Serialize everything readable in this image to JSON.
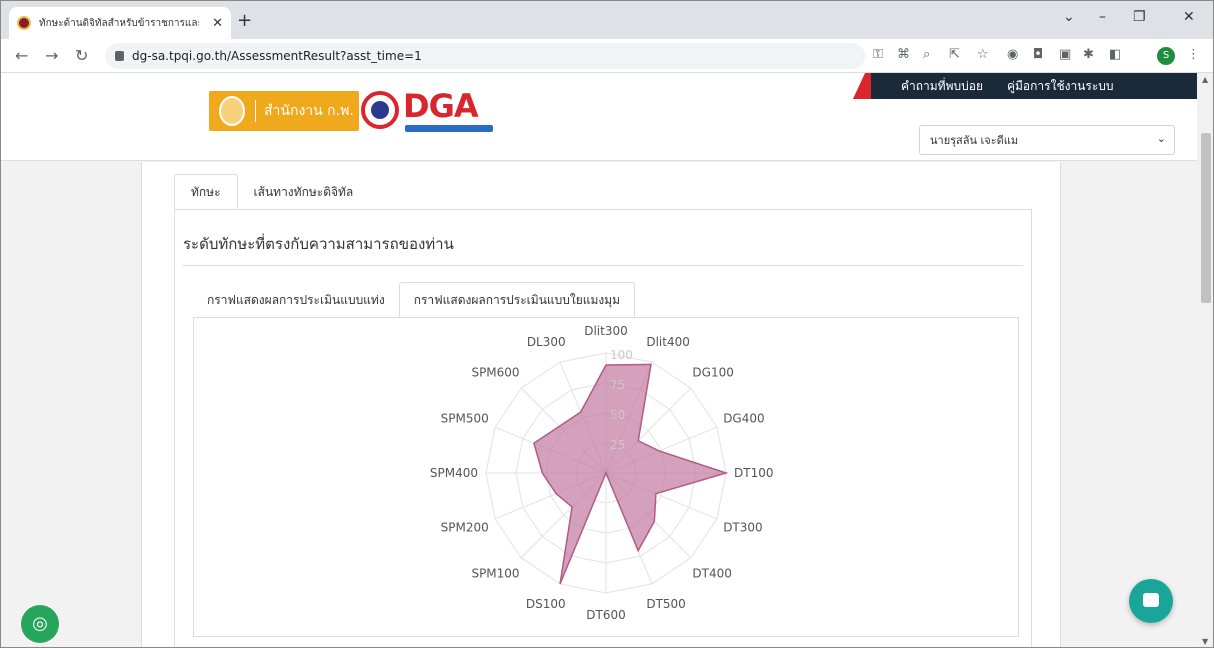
{
  "browser": {
    "tab_title": "ทักษะด้านดิจิทัลสำหรับข้าราชการและบุ",
    "url": "dg-sa.tpqi.go.th/AssessmentResult?asst_time=1",
    "profile_initial": "S"
  },
  "header": {
    "links": [
      "คำถามที่พบบ่อย",
      "คู่มือการใช้งานระบบ"
    ],
    "ocsc_logo_text": "สำนักงาน ก.พ.",
    "dga_logo_text": "DGA",
    "user_name": "นายรุสลัน เจะดีแม"
  },
  "tabs": {
    "outer": [
      "ทักษะ",
      "เส้นทางทักษะดิจิทัล"
    ],
    "outer_active": 0,
    "section_title": "ระดับทักษะที่ตรงกับความสามารถของท่าน",
    "inner": [
      "กราฟแสดงผลการประเมินแบบแท่ง",
      "กราฟแสดงผลการประเมินแบบใยแมงมุม"
    ],
    "inner_active": 1
  },
  "chart_data": {
    "type": "radar",
    "categories": [
      "Dlit300",
      "Dlit400",
      "DG100",
      "DG400",
      "DT100",
      "DT300",
      "DT400",
      "DT500",
      "DT600",
      "DS100",
      "SPM100",
      "SPM200",
      "SPM400",
      "SPM500",
      "SPM600",
      "DL300"
    ],
    "values": [
      90,
      98,
      38,
      48,
      100,
      45,
      57,
      70,
      0,
      100,
      40,
      45,
      53,
      65,
      55,
      55
    ],
    "r_ticks": [
      25,
      50,
      75,
      100
    ],
    "r_max": 100,
    "fill_color": "#c2789e",
    "fill_opacity": 0.7
  }
}
